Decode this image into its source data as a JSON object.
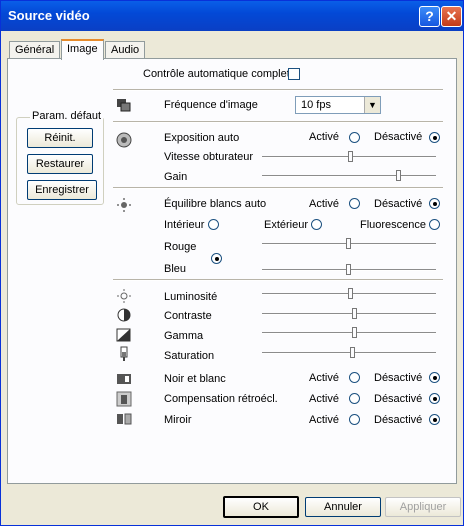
{
  "window": {
    "title": "Source vidéo",
    "help_glyph": "?",
    "close_glyph": "✕"
  },
  "tabs": [
    {
      "label": "Général"
    },
    {
      "label": "Image"
    },
    {
      "label": "Audio"
    }
  ],
  "auto_control": {
    "label": "Contrôle automatique complet",
    "checked": false
  },
  "defaults": {
    "legend": "Param. défaut",
    "reset": "Réinit.",
    "restore": "Restaurer",
    "save": "Enregistrer"
  },
  "frame_rate": {
    "label": "Fréquence d'image",
    "value": "10 fps"
  },
  "exposure": {
    "label": "Exposition auto",
    "on": "Activé",
    "off": "Désactivé",
    "selected": "off"
  },
  "shutter": {
    "label": "Vitesse obturateur",
    "level": 0.5
  },
  "gain": {
    "label": "Gain",
    "level": 0.77
  },
  "white_balance": {
    "label": "Équilibre blancs auto",
    "on": "Activé",
    "off": "Désactivé",
    "selected": "off"
  },
  "wb_modes": {
    "indoor": "Intérieur",
    "outdoor": "Extérieur",
    "fluorescent": "Fluorescence"
  },
  "red": {
    "label": "Rouge",
    "level": 0.5
  },
  "blue": {
    "label": "Bleu",
    "level": 0.5
  },
  "brightness": {
    "label": "Luminosité",
    "level": 0.5
  },
  "contrast": {
    "label": "Contraste",
    "level": 0.53
  },
  "gamma": {
    "label": "Gamma",
    "level": 0.53
  },
  "saturation": {
    "label": "Saturation",
    "level": 0.52
  },
  "bw": {
    "label": "Noir et blanc",
    "on": "Activé",
    "off": "Désactivé",
    "selected": "off"
  },
  "backlight": {
    "label": "Compensation rétroécl.",
    "on": "Activé",
    "off": "Désactivé",
    "selected": "off"
  },
  "mirror": {
    "label": "Miroir",
    "on": "Activé",
    "off": "Désactivé",
    "selected": "off"
  },
  "footer": {
    "ok": "OK",
    "cancel": "Annuler",
    "apply": "Appliquer"
  }
}
